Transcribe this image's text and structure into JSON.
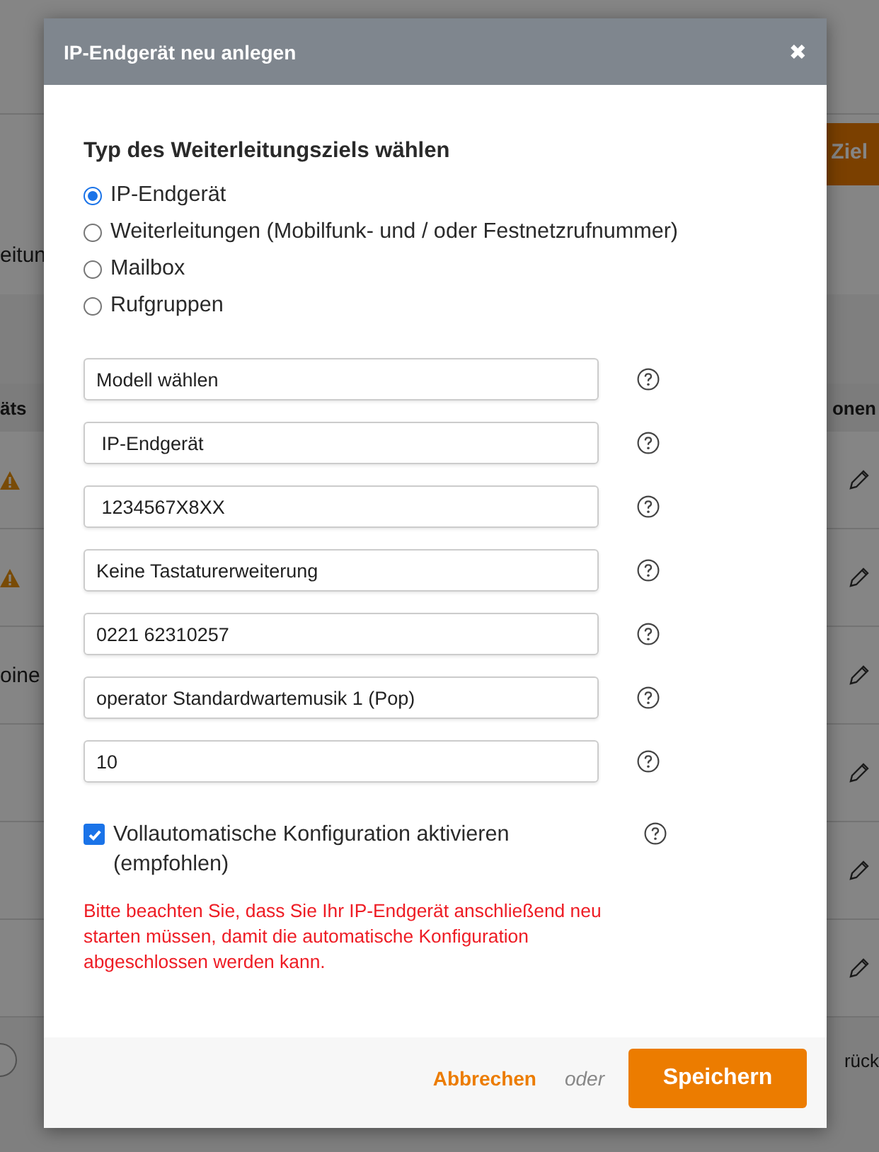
{
  "background": {
    "button": "Ziel",
    "label": "eitun",
    "column_1": "äts",
    "column_2": "onen",
    "footer_text": "rück",
    "rows": [
      {
        "cell": "",
        "warning": true
      },
      {
        "cell": "",
        "warning": true
      },
      {
        "cell": "oine",
        "warning": false
      },
      {
        "cell": "",
        "warning": false
      },
      {
        "cell": "",
        "warning": false
      },
      {
        "cell": "",
        "warning": false
      }
    ]
  },
  "dialog": {
    "title": "IP-Endgerät neu anlegen",
    "close": "✖",
    "section_title": "Typ des Weiterleitungsziels wählen",
    "options": [
      {
        "label": "IP-Endgerät",
        "selected": true
      },
      {
        "label": "Weiterleitungen (Mobilfunk- und / oder Festnetzrufnummer)",
        "selected": false
      },
      {
        "label": "Mailbox",
        "selected": false
      },
      {
        "label": "Rufgruppen",
        "selected": false
      }
    ],
    "fields": [
      {
        "value": "Modell wählen"
      },
      {
        "value": " IP-Endgerät"
      },
      {
        "value": " 1234567X8XX"
      },
      {
        "value": "Keine Tastaturerweiterung"
      },
      {
        "value": "0221 62310257"
      },
      {
        "value": "operator Standardwartemusik 1 (Pop)"
      },
      {
        "value": "10"
      }
    ],
    "auto_config": {
      "label": "Vollautomatische Konfiguration aktivieren (empfohlen)",
      "checked": true
    },
    "notice": "Bitte beachten Sie, dass Sie Ihr IP-Endgerät anschließend neu starten müssen, damit die automatische Konfiguration abgeschlossen werden kann.",
    "cancel": "Abbrechen",
    "or": "oder",
    "save": "Speichern"
  }
}
